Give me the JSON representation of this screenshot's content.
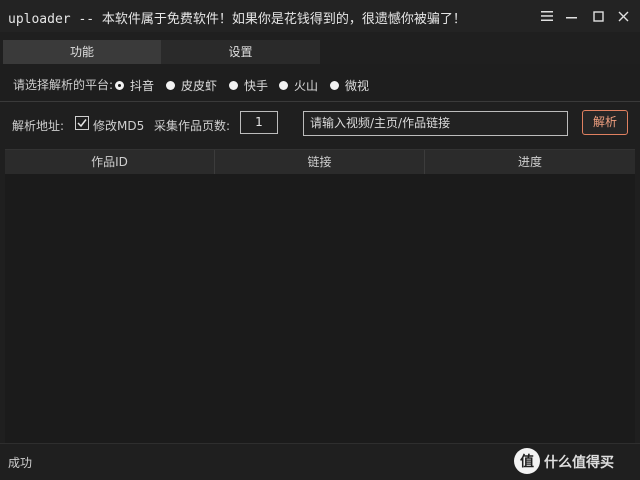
{
  "window": {
    "title": "uploader -- 本软件属于免费软件！如果你是花钱得到的，很遗憾你被骗了！",
    "controls": [
      "menu-icon",
      "minimize-icon",
      "maximize-icon",
      "close-icon"
    ]
  },
  "tabs": [
    {
      "label": "功能",
      "active": true
    },
    {
      "label": "设置",
      "active": false
    }
  ],
  "platform": {
    "label": "请选择解析的平台:",
    "options": [
      {
        "label": "抖音",
        "selected": true
      },
      {
        "label": "皮皮虾",
        "selected": false
      },
      {
        "label": "快手",
        "selected": false
      },
      {
        "label": "火山",
        "selected": false
      },
      {
        "label": "微视",
        "selected": false
      }
    ]
  },
  "parse": {
    "address_label": "解析地址:",
    "md5_label": "修改MD5",
    "md5_checked": true,
    "pages_label": "采集作品页数:",
    "pages_value": "1",
    "url_placeholder": "请输入视频/主页/作品链接",
    "parse_button": "解析",
    "parse_button_color": "#e08060"
  },
  "table": {
    "columns": [
      "作品ID",
      "链接",
      "进度"
    ],
    "rows": []
  },
  "status": {
    "text": "成功"
  },
  "watermark": {
    "text": "什么值得买"
  }
}
